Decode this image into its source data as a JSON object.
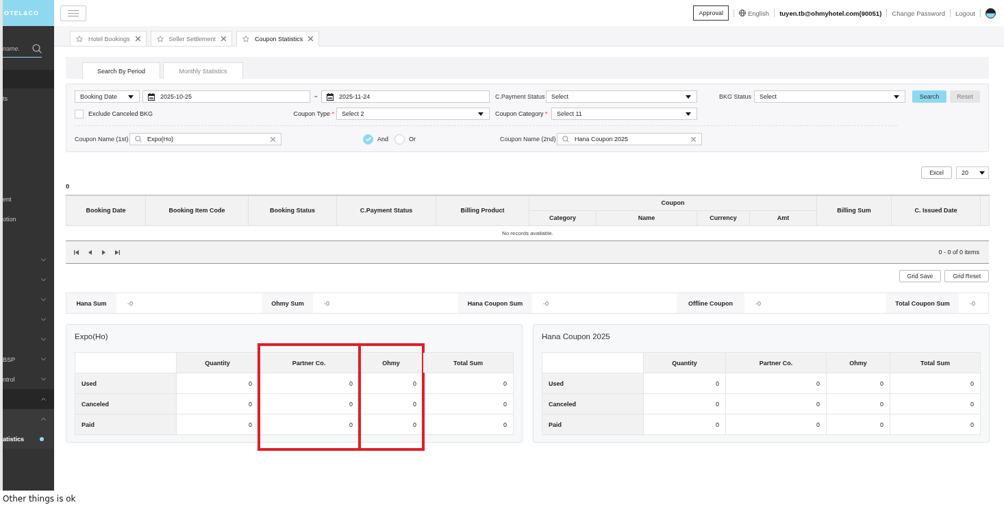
{
  "sidebar": {
    "logo": "OTEL&CO",
    "search": {
      "placeholder": "name."
    },
    "sections": [
      [
        {
          "kind": "link",
          "label": "ts",
          "selected": false
        }
      ],
      [
        {
          "kind": "link",
          "label": "ent",
          "selected": false
        },
        {
          "kind": "link",
          "label": "otion",
          "selected": false
        }
      ],
      [
        {
          "kind": "group",
          "expanded": false
        },
        {
          "kind": "group",
          "expanded": false
        },
        {
          "kind": "group",
          "expanded": false
        },
        {
          "kind": "group",
          "expanded": false
        },
        {
          "kind": "group",
          "expanded": false
        },
        {
          "kind": "group",
          "label": "BSP",
          "expanded": false
        },
        {
          "kind": "group",
          "label": "ntrol",
          "expanded": false
        },
        {
          "kind": "group",
          "expanded": true,
          "children": [
            {
              "kind": "group",
              "expanded": true,
              "children": [
                {
                  "kind": "link",
                  "label": "atistics",
                  "selected": true
                }
              ]
            }
          ]
        }
      ]
    ]
  },
  "header": {
    "approval": "Approval",
    "language": "English",
    "user": "tuyen.tb@ohmyhotel.com(90051)",
    "links": [
      "Change Password",
      "Logout"
    ]
  },
  "tabs": [
    {
      "label": "Hotel Bookings",
      "selected": false
    },
    {
      "label": "Seller Settlement",
      "selected": false
    },
    {
      "label": "Coupon Statistics",
      "selected": true
    }
  ],
  "subtabs": [
    {
      "label": "Search By Period",
      "selected": true
    },
    {
      "label": "Monthly Statistics",
      "selected": false
    }
  ],
  "filters": {
    "date_type": "Booking Date",
    "date_from": "2025-10-25",
    "separator": "~",
    "date_to": "2025-11-24",
    "payment_status": {
      "label": "C.Payment Status",
      "value": "Select"
    },
    "bkg_status": {
      "label": "BKG Status",
      "value": "Select"
    },
    "search": "Search",
    "reset": "Reset",
    "exclude_canceled": {
      "label": "Exclude Canceled BKG",
      "checked": false
    },
    "coupon_type": {
      "label": "Coupon Type",
      "required_mark": "*",
      "value": "Select 2"
    },
    "coupon_category": {
      "label": "Coupon Category",
      "required_mark": "*",
      "value": "Select 11"
    },
    "coupon_name_1": {
      "label": "Coupon Name (1st)",
      "value": "Expo(Ho)"
    },
    "logic": [
      {
        "label": "And",
        "selected": true
      },
      {
        "label": "Or",
        "selected": false
      }
    ],
    "coupon_name_2": {
      "label": "Coupon Name (2nd)",
      "value": "Hana Coupon 2025"
    }
  },
  "grid": {
    "excel": "Excel",
    "page_size": "20",
    "count": "0",
    "columns": [
      {
        "label": "Booking Date"
      },
      {
        "label": "Booking Item Code"
      },
      {
        "label": "Booking Status"
      },
      {
        "label": "C.Payment Status"
      },
      {
        "label": "Billing Product"
      },
      {
        "label": "Coupon",
        "children": [
          {
            "label": "Category"
          },
          {
            "label": "Name"
          },
          {
            "label": "Currency"
          },
          {
            "label": "Amt"
          }
        ]
      },
      {
        "label": "Billing Sum"
      },
      {
        "label": "C. Issued Date"
      }
    ],
    "empty": "No records available.",
    "pager": "0 - 0 of 0 items",
    "buttons": [
      "Grid Save",
      "Grid Reset"
    ]
  },
  "sums": [
    {
      "label": "Hana Sum",
      "value": "-0"
    },
    {
      "label": "Ohmy Sum",
      "value": "-0"
    },
    {
      "label": "Hana Coupon Sum",
      "value": "-0"
    },
    {
      "label": "Offline Coupon",
      "value": "-0"
    },
    {
      "label": "Total Coupon Sum",
      "value": "-0"
    }
  ],
  "cards": [
    {
      "title": "Expo(Ho)",
      "columns": [
        {
          "label": "Quantity",
          "highlighted": false
        },
        {
          "label": "Partner Co.",
          "highlighted": true
        },
        {
          "label": "Ohmy",
          "highlighted": true
        },
        {
          "label": "Total Sum",
          "highlighted": false
        }
      ],
      "rows": [
        {
          "label": "Used",
          "values": [
            "0",
            "0",
            "0",
            "0"
          ]
        },
        {
          "label": "Canceled",
          "values": [
            "0",
            "0",
            "0",
            "0"
          ]
        },
        {
          "label": "Paid",
          "values": [
            "0",
            "0",
            "0",
            "0"
          ]
        }
      ]
    },
    {
      "title": "Hana Coupon 2025",
      "columns": [
        {
          "label": "Quantity",
          "highlighted": false
        },
        {
          "label": "Partner Co.",
          "highlighted": false
        },
        {
          "label": "Ohmy",
          "highlighted": false
        },
        {
          "label": "Total Sum",
          "highlighted": false
        }
      ],
      "rows": [
        {
          "label": "Used",
          "values": [
            "0",
            "0",
            "0",
            "0"
          ]
        },
        {
          "label": "Canceled",
          "values": [
            "0",
            "0",
            "0",
            "0"
          ]
        },
        {
          "label": "Paid",
          "values": [
            "0",
            "0",
            "0",
            "0"
          ]
        }
      ]
    }
  ],
  "caption": "Other things is ok"
}
